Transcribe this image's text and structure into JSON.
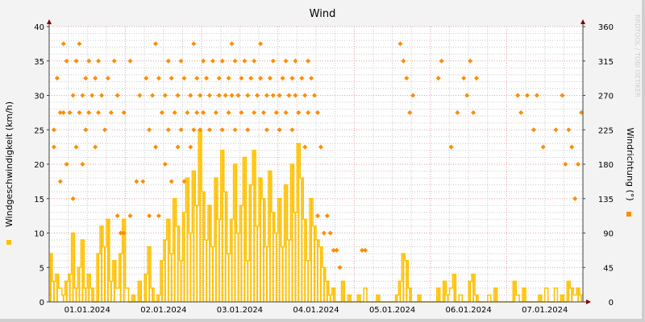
{
  "chart_data": {
    "type": "line",
    "title": "Wind",
    "ylabel": "Windgeschwindigkeit (km/h)",
    "y2label": "Windrichtung (°)",
    "watermark": "RRDTOOL / TOBI OETIKER",
    "ylim": [
      0,
      40
    ],
    "y2lim": [
      0,
      360
    ],
    "yticks": [
      "0",
      "5",
      "10",
      "15",
      "20",
      "25",
      "30",
      "35",
      "40"
    ],
    "y2ticks": [
      "0",
      "45",
      "90",
      "135",
      "180",
      "225",
      "270",
      "315",
      "360"
    ],
    "xticks": [
      "01.01.2024",
      "02.01.2024",
      "03.01.2024",
      "04.01.2024",
      "05.01.2024",
      "06.01.2024",
      "07.01.2024"
    ],
    "x_unit": "hours since 01.01.2024 00:00",
    "xlim": [
      0,
      168
    ],
    "grid": true,
    "colors": {
      "speed": "#ffc000",
      "direction": "#ff8c00",
      "grid_major": "#e0a0a0",
      "grid_minor": "#c8c8c8",
      "axis": "#404040",
      "arrow": "#800000"
    },
    "series": [
      {
        "name": "Windgeschwindigkeit",
        "axis": "left",
        "style": "step-line",
        "values": [
          7,
          3,
          4,
          2,
          1,
          3,
          4,
          10,
          2,
          5,
          9,
          2,
          4,
          2,
          0,
          7,
          11,
          8,
          12,
          3,
          6,
          2,
          7,
          12,
          2,
          0,
          1,
          0,
          3,
          0,
          4,
          8,
          2,
          0,
          1,
          6,
          9,
          12,
          7,
          15,
          11,
          6,
          13,
          18,
          10,
          19,
          14,
          25,
          16,
          9,
          14,
          8,
          18,
          12,
          22,
          16,
          7,
          12,
          20,
          10,
          14,
          21,
          6,
          17,
          22,
          11,
          18,
          15,
          8,
          19,
          13,
          10,
          15,
          8,
          17,
          9,
          20,
          13,
          23,
          18,
          12,
          6,
          15,
          11,
          9,
          8,
          5,
          3,
          1,
          2,
          0,
          0,
          3,
          0,
          1,
          0,
          0,
          1,
          0,
          2,
          0,
          0,
          0,
          1,
          0,
          0,
          0,
          0,
          0,
          1,
          3,
          7,
          6,
          2,
          0,
          0,
          1,
          0,
          0,
          0,
          0,
          0,
          2,
          0,
          3,
          1,
          2,
          4,
          0,
          1,
          0,
          0,
          3,
          4,
          1,
          0,
          0,
          0,
          1,
          0,
          2,
          0,
          0,
          0,
          0,
          0,
          3,
          1,
          0,
          2,
          0,
          0,
          0,
          0,
          1,
          0,
          2,
          0,
          0,
          2,
          0,
          1,
          0,
          3,
          2,
          1,
          2,
          1
        ]
      },
      {
        "name": "Windrichtung",
        "axis": "right",
        "style": "points",
        "points": [
          [
            1,
            202.5
          ],
          [
            1,
            225
          ],
          [
            2,
            292.5
          ],
          [
            3,
            157.5
          ],
          [
            3,
            247.5
          ],
          [
            4,
            337.5
          ],
          [
            4,
            247.5
          ],
          [
            5,
            315
          ],
          [
            5,
            180
          ],
          [
            6,
            247.5
          ],
          [
            7,
            135
          ],
          [
            7,
            270
          ],
          [
            8,
            315
          ],
          [
            8,
            202.5
          ],
          [
            9,
            337.5
          ],
          [
            9,
            247.5
          ],
          [
            10,
            270
          ],
          [
            10,
            180
          ],
          [
            11,
            292.5
          ],
          [
            11,
            225
          ],
          [
            12,
            315
          ],
          [
            12,
            247.5
          ],
          [
            13,
            270
          ],
          [
            14,
            292.5
          ],
          [
            14,
            202.5
          ],
          [
            15,
            315
          ],
          [
            15,
            247.5
          ],
          [
            16,
            270
          ],
          [
            17,
            225
          ],
          [
            18,
            292.5
          ],
          [
            19,
            247.5
          ],
          [
            20,
            315
          ],
          [
            21,
            270
          ],
          [
            21,
            112.5
          ],
          [
            22,
            90
          ],
          [
            23,
            247.5
          ],
          [
            23,
            90
          ],
          [
            25,
            315
          ],
          [
            25,
            112.5
          ],
          [
            27,
            157.5
          ],
          [
            28,
            270
          ],
          [
            29,
            157.5
          ],
          [
            30,
            292.5
          ],
          [
            31,
            225
          ],
          [
            31,
            112.5
          ],
          [
            32,
            270
          ],
          [
            33,
            337.5
          ],
          [
            33,
            202.5
          ],
          [
            34,
            292.5
          ],
          [
            34,
            112.5
          ],
          [
            35,
            247.5
          ],
          [
            36,
            270
          ],
          [
            36,
            180
          ],
          [
            37,
            315
          ],
          [
            37,
            225
          ],
          [
            38,
            292.5
          ],
          [
            38,
            157.5
          ],
          [
            39,
            247.5
          ],
          [
            40,
            270
          ],
          [
            40,
            202.5
          ],
          [
            41,
            315
          ],
          [
            41,
            225
          ],
          [
            42,
            292.5
          ],
          [
            42,
            157.5
          ],
          [
            43,
            247.5
          ],
          [
            44,
            270
          ],
          [
            44,
            202.5
          ],
          [
            45,
            337.5
          ],
          [
            45,
            225
          ],
          [
            46,
            292.5
          ],
          [
            46,
            247.5
          ],
          [
            47,
            270
          ],
          [
            47,
            225
          ],
          [
            48,
            315
          ],
          [
            48,
            247.5
          ],
          [
            49,
            292.5
          ],
          [
            50,
            270
          ],
          [
            50,
            225
          ],
          [
            51,
            315
          ],
          [
            52,
            247.5
          ],
          [
            53,
            292.5
          ],
          [
            53,
            270
          ],
          [
            54,
            315
          ],
          [
            54,
            225
          ],
          [
            55,
            270
          ],
          [
            56,
            292.5
          ],
          [
            56,
            247.5
          ],
          [
            57,
            337.5
          ],
          [
            57,
            270
          ],
          [
            58,
            315
          ],
          [
            58,
            225
          ],
          [
            59,
            270
          ],
          [
            60,
            292.5
          ],
          [
            60,
            247.5
          ],
          [
            61,
            315
          ],
          [
            62,
            270
          ],
          [
            62,
            225
          ],
          [
            63,
            292.5
          ],
          [
            64,
            247.5
          ],
          [
            64,
            315
          ],
          [
            65,
            270
          ],
          [
            66,
            337.5
          ],
          [
            66,
            292.5
          ],
          [
            67,
            247.5
          ],
          [
            68,
            270
          ],
          [
            68,
            225
          ],
          [
            69,
            292.5
          ],
          [
            70,
            315
          ],
          [
            70,
            270
          ],
          [
            71,
            247.5
          ],
          [
            72,
            270
          ],
          [
            72,
            225
          ],
          [
            73,
            292.5
          ],
          [
            74,
            315
          ],
          [
            74,
            247.5
          ],
          [
            75,
            270
          ],
          [
            76,
            292.5
          ],
          [
            76,
            225
          ],
          [
            77,
            315
          ],
          [
            77,
            270
          ],
          [
            78,
            247.5
          ],
          [
            79,
            292.5
          ],
          [
            80,
            270
          ],
          [
            80,
            202.5
          ],
          [
            81,
            315
          ],
          [
            81,
            247.5
          ],
          [
            82,
            292.5
          ],
          [
            83,
            270
          ],
          [
            84,
            247.5
          ],
          [
            84,
            112.5
          ],
          [
            85,
            202.5
          ],
          [
            86,
            90
          ],
          [
            87,
            112.5
          ],
          [
            88,
            90
          ],
          [
            89,
            67.5
          ],
          [
            90,
            67.5
          ],
          [
            91,
            45
          ],
          [
            98,
            67.5
          ],
          [
            99,
            67.5
          ],
          [
            110,
            337.5
          ],
          [
            111,
            315
          ],
          [
            112,
            292.5
          ],
          [
            113,
            247.5
          ],
          [
            114,
            270
          ],
          [
            122,
            292.5
          ],
          [
            123,
            315
          ],
          [
            126,
            202.5
          ],
          [
            128,
            247.5
          ],
          [
            130,
            292.5
          ],
          [
            131,
            270
          ],
          [
            132,
            315
          ],
          [
            133,
            247.5
          ],
          [
            134,
            292.5
          ],
          [
            147,
            270
          ],
          [
            148,
            247.5
          ],
          [
            150,
            270
          ],
          [
            152,
            225
          ],
          [
            153,
            270
          ],
          [
            155,
            202.5
          ],
          [
            159,
            225
          ],
          [
            161,
            270
          ],
          [
            162,
            180
          ],
          [
            163,
            225
          ],
          [
            164,
            202.5
          ],
          [
            165,
            135
          ],
          [
            166,
            180
          ],
          [
            167,
            247.5
          ]
        ]
      }
    ]
  }
}
